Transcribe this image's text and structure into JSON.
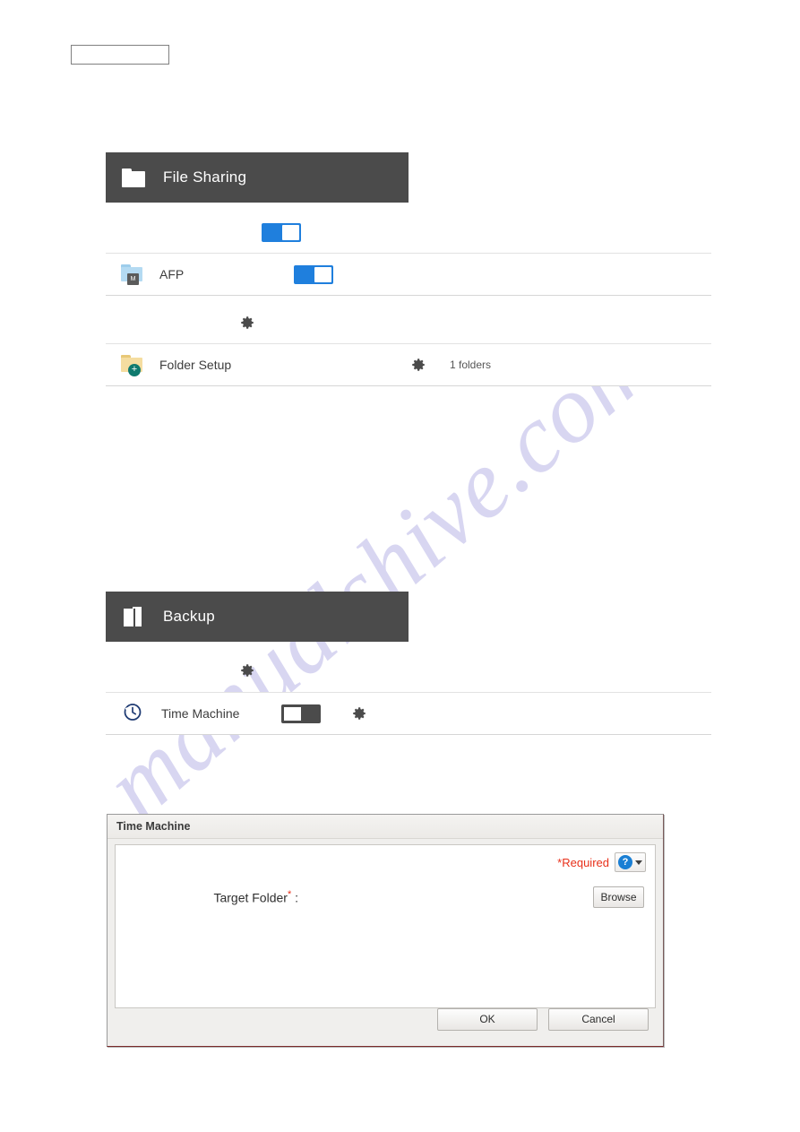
{
  "page": {
    "watermark": "manualshive.com"
  },
  "top_box": {
    "value": ""
  },
  "sections": {
    "file_sharing": {
      "title": "File Sharing",
      "icon": "folder-icon",
      "master_toggle": {
        "state": "on",
        "label": ""
      },
      "gear": "gear-icon",
      "rows": [
        {
          "id": "afp",
          "icon": "afp-folder-icon",
          "icon_badge": "M",
          "label": "AFP",
          "toggle_state": "on",
          "meta": ""
        },
        {
          "id": "folder-setup",
          "icon": "folder-add-icon",
          "label": "Folder Setup",
          "gear": "gear-icon",
          "meta": "1 folders"
        }
      ]
    },
    "backup": {
      "title": "Backup",
      "icon": "backup-icon",
      "gear": "gear-icon",
      "rows": [
        {
          "id": "time-machine",
          "icon": "clock-icon",
          "label": "Time Machine",
          "toggle_state": "off",
          "gear": "gear-icon",
          "meta": ""
        }
      ]
    }
  },
  "dialog": {
    "title": "Time Machine",
    "required_note": "*Required",
    "help_icon": "help-icon",
    "target_folder_label": "Target Folder",
    "target_folder_required_mark": "*",
    "target_folder_colon": ":",
    "target_folder_value": "",
    "browse_label": "Browse",
    "ok_label": "OK",
    "cancel_label": "Cancel"
  },
  "colors": {
    "section_header_bg": "#4b4b4b",
    "toggle_on": "#1f7fdd",
    "toggle_off": "#4b4b4b",
    "required_red": "#e8301a",
    "help_blue": "#1a7fd4",
    "folder_add_badge": "#0f7a6e",
    "afp_folder": "#b4daf2",
    "watermark": "#b9b6e6"
  }
}
